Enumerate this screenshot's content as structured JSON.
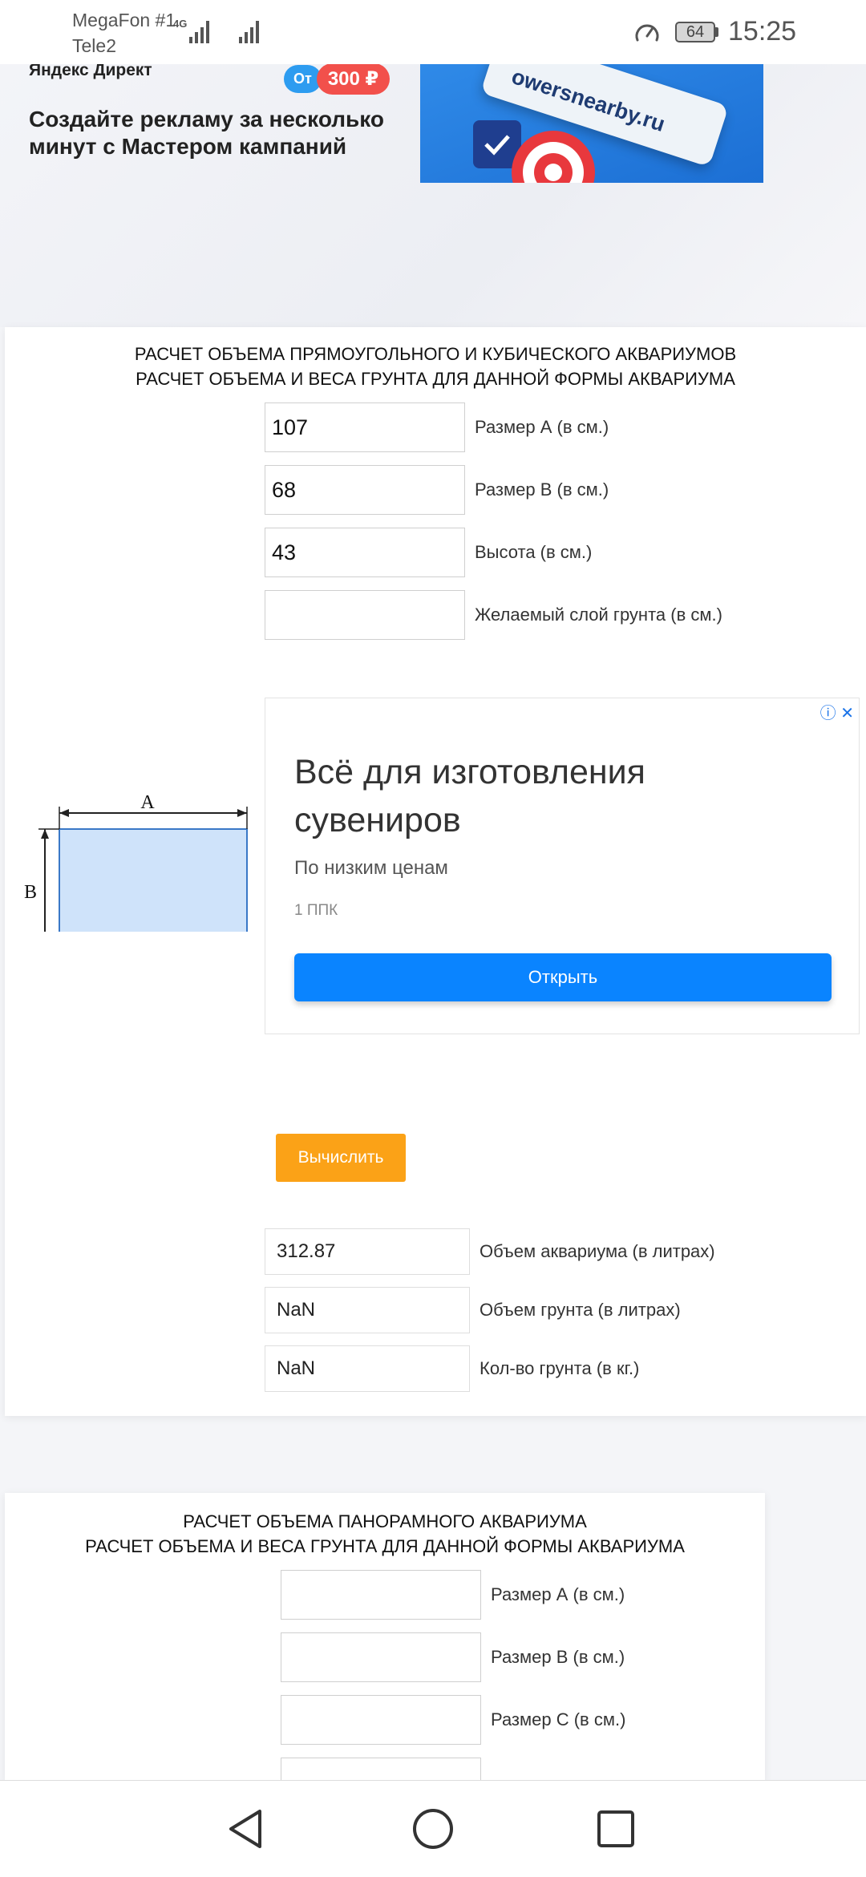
{
  "status_bar": {
    "carrier1": "MegaFon #1",
    "carrier2": "Tele2",
    "network": "4G",
    "battery": "64",
    "time": "15:25"
  },
  "top_ad": {
    "brand": "Яндекс Директ",
    "price_prefix": "От",
    "price": "300 ₽",
    "headline": "Создайте рекламу за несколько минут с Мастером кампаний",
    "url": "owersnearby.ru"
  },
  "card1": {
    "title_line1": "РАСЧЕТ ОБЪЕМА ПРЯМОУГОЛЬНОГО И КУБИЧЕСКОГО АКВАРИУМОВ",
    "title_line2": "РАСЧЕТ ОБЪЕМА И ВЕСА ГРУНТА ДЛЯ ДАННОЙ ФОРМЫ АКВАРИУМА",
    "inputs": [
      {
        "value": "107",
        "label": "Размер А (в см.)"
      },
      {
        "value": "68",
        "label": "Размер В (в см.)"
      },
      {
        "value": "43",
        "label": "Высота (в см.)"
      },
      {
        "value": "",
        "label": "Желаемый слой грунта (в см.)"
      }
    ],
    "diagram": {
      "label_a": "A",
      "label_b": "B"
    },
    "ad": {
      "title": "Всё для изготовления сувениров",
      "subtitle": "По низким ценам",
      "source": "1 ППК",
      "button": "Открыть"
    },
    "calc_button": "Вычислить",
    "results": [
      {
        "value": "312.87",
        "label": "Объем аквариума (в литрах)"
      },
      {
        "value": "NaN",
        "label": "Объем грунта (в литрах)"
      },
      {
        "value": "NaN",
        "label": "Кол-во грунта (в кг.)"
      }
    ]
  },
  "card2": {
    "title_line1": "РАСЧЕТ ОБЪЕМА ПАНОРАМНОГО АКВАРИУМА",
    "title_line2": "РАСЧЕТ ОБЪЕМА И ВЕСА ГРУНТА ДЛЯ ДАННОЙ ФОРМЫ АКВАРИУМА",
    "inputs": [
      {
        "value": "",
        "label": "Размер А (в см.)"
      },
      {
        "value": "",
        "label": "Размер В (в см.)"
      },
      {
        "value": "",
        "label": "Размер С (в см.)"
      }
    ]
  },
  "nav_bar": {
    "back": "back-icon",
    "home": "home-icon",
    "recents": "recents-icon"
  }
}
